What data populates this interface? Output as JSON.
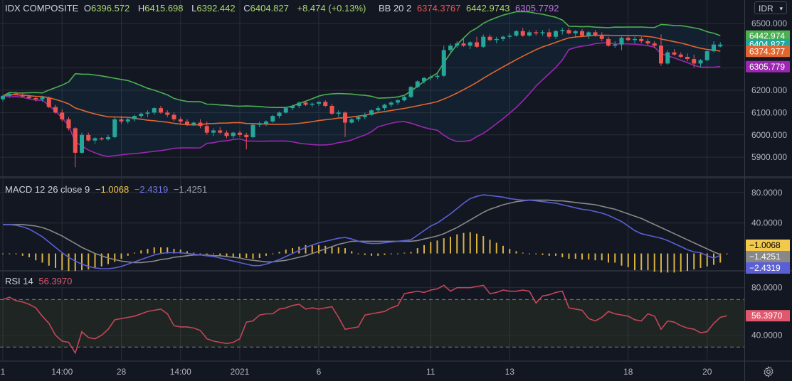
{
  "header": {
    "symbol": "IDX COMPOSITE",
    "open_label": "O",
    "open": "6396.572",
    "high_label": "H",
    "high": "6415.698",
    "low_label": "L",
    "low": "6392.442",
    "close_label": "C",
    "close": "6404.827",
    "change": "+8.474 (+0.13%)",
    "bb_label": "BB 20 2",
    "bb_mid": "6374.3767",
    "bb_upper": "6442.9743",
    "bb_lower": "6305.7792"
  },
  "macd_header": {
    "label": "MACD 12 26 close 9",
    "hist": "−1.0068",
    "macd": "−2.4319",
    "signal": "−1.4251"
  },
  "rsi_header": {
    "label": "RSI 14",
    "value": "56.3970"
  },
  "currency": "IDR",
  "colors": {
    "bg": "#131722",
    "grid": "#2a2e39",
    "up": "#26a69a",
    "down": "#ef5350",
    "bb_upper": "#4caf50",
    "bb_mid": "#e0662f",
    "bb_lower": "#9c27b0",
    "macd": "#5b5fd4",
    "signal": "#888888",
    "hist": "#d9b23f",
    "rsi": "#c4455a",
    "last_price": "#26a69a"
  },
  "chart_data": [
    {
      "type": "candlestick",
      "title": "IDX COMPOSITE",
      "ylim": [
        5840,
        6525
      ],
      "y_ticks": [
        "6500.000",
        "6400.000",
        "6300.000",
        "6200.000",
        "6100.000",
        "6000.000",
        "5900.000"
      ],
      "x_tick_labels": [
        "1",
        "14:00",
        "28",
        "14:00",
        "2021",
        "6",
        "11",
        "13",
        "18",
        "20"
      ],
      "price_labels": [
        {
          "value": 6442.974,
          "text": "6442.974",
          "color": "#4caf50"
        },
        {
          "value": 6404.827,
          "text": "6404.827",
          "color": "#26a69a"
        },
        {
          "value": 6374.377,
          "text": "6374.377",
          "color": "#e0662f"
        },
        {
          "value": 6305.779,
          "text": "6305.779",
          "color": "#9c27b0"
        }
      ],
      "candles": [
        [
          6160,
          6178,
          6150,
          6175
        ],
        [
          6175,
          6190,
          6168,
          6185
        ],
        [
          6185,
          6195,
          6178,
          6180
        ],
        [
          6180,
          6188,
          6170,
          6172
        ],
        [
          6172,
          6180,
          6160,
          6165
        ],
        [
          6165,
          6172,
          6150,
          6160
        ],
        [
          6160,
          6175,
          6150,
          6168
        ],
        [
          6168,
          6172,
          6120,
          6125
        ],
        [
          6125,
          6135,
          6095,
          6100
        ],
        [
          6100,
          6115,
          6060,
          6070
        ],
        [
          6070,
          6080,
          6020,
          6030
        ],
        [
          6030,
          6035,
          5855,
          5920
        ],
        [
          5920,
          6010,
          5915,
          6000
        ],
        [
          6000,
          6010,
          5970,
          5975
        ],
        [
          5975,
          5990,
          5960,
          5985
        ],
        [
          5985,
          5990,
          5975,
          5980
        ],
        [
          5980,
          6000,
          5975,
          5990
        ],
        [
          5990,
          6080,
          5985,
          6070
        ],
        [
          6070,
          6085,
          6050,
          6060
        ],
        [
          6060,
          6080,
          6050,
          6070
        ],
        [
          6070,
          6090,
          6060,
          6085
        ],
        [
          6085,
          6100,
          6075,
          6095
        ],
        [
          6095,
          6110,
          6080,
          6100
        ],
        [
          6100,
          6125,
          6090,
          6120
        ],
        [
          6120,
          6130,
          6095,
          6100
        ],
        [
          6100,
          6110,
          6080,
          6090
        ],
        [
          6090,
          6100,
          6060,
          6070
        ],
        [
          6070,
          6080,
          6050,
          6060
        ],
        [
          6060,
          6070,
          6040,
          6045
        ],
        [
          6045,
          6060,
          6040,
          6055
        ],
        [
          6055,
          6070,
          6030,
          6040
        ],
        [
          6040,
          6060,
          6000,
          6010
        ],
        [
          6010,
          6030,
          5995,
          6020
        ],
        [
          6020,
          6035,
          6005,
          6010
        ],
        [
          6010,
          6020,
          5985,
          5995
        ],
        [
          5995,
          6015,
          5985,
          6010
        ],
        [
          6010,
          6020,
          5990,
          6000
        ],
        [
          6000,
          6010,
          5935,
          5990
        ],
        [
          5990,
          6050,
          5985,
          6045
        ],
        [
          6045,
          6060,
          6035,
          6050
        ],
        [
          6050,
          6065,
          6040,
          6060
        ],
        [
          6060,
          6090,
          6055,
          6085
        ],
        [
          6085,
          6105,
          6075,
          6100
        ],
        [
          6100,
          6125,
          6095,
          6120
        ],
        [
          6120,
          6135,
          6110,
          6130
        ],
        [
          6130,
          6150,
          6120,
          6145
        ],
        [
          6145,
          6150,
          6130,
          6135
        ],
        [
          6135,
          6145,
          6125,
          6140
        ],
        [
          6140,
          6150,
          6130,
          6148
        ],
        [
          6148,
          6155,
          6125,
          6130
        ],
        [
          6130,
          6140,
          6090,
          6095
        ],
        [
          6095,
          6110,
          6080,
          6100
        ],
        [
          6100,
          6105,
          5990,
          6055
        ],
        [
          6055,
          6075,
          6050,
          6070
        ],
        [
          6070,
          6085,
          6060,
          6080
        ],
        [
          6080,
          6100,
          6070,
          6090
        ],
        [
          6090,
          6115,
          6085,
          6110
        ],
        [
          6110,
          6130,
          6100,
          6120
        ],
        [
          6120,
          6140,
          6110,
          6135
        ],
        [
          6135,
          6150,
          6125,
          6145
        ],
        [
          6145,
          6160,
          6135,
          6155
        ],
        [
          6155,
          6175,
          6150,
          6170
        ],
        [
          6170,
          6220,
          6165,
          6215
        ],
        [
          6215,
          6245,
          6210,
          6240
        ],
        [
          6240,
          6260,
          6230,
          6255
        ],
        [
          6255,
          6270,
          6245,
          6260
        ],
        [
          6260,
          6275,
          6250,
          6265
        ],
        [
          6265,
          6400,
          6260,
          6380
        ],
        [
          6380,
          6410,
          6370,
          6400
        ],
        [
          6400,
          6420,
          6390,
          6410
        ],
        [
          6410,
          6430,
          6395,
          6400
        ],
        [
          6400,
          6420,
          6385,
          6415
        ],
        [
          6415,
          6440,
          6390,
          6395
        ],
        [
          6395,
          6450,
          6390,
          6440
        ],
        [
          6440,
          6450,
          6420,
          6425
        ],
        [
          6425,
          6440,
          6410,
          6430
        ],
        [
          6430,
          6445,
          6420,
          6440
        ],
        [
          6440,
          6455,
          6430,
          6445
        ],
        [
          6445,
          6470,
          6440,
          6465
        ],
        [
          6465,
          6480,
          6440,
          6445
        ],
        [
          6445,
          6470,
          6440,
          6460
        ],
        [
          6460,
          6470,
          6445,
          6455
        ],
        [
          6455,
          6470,
          6445,
          6460
        ],
        [
          6460,
          6475,
          6430,
          6440
        ],
        [
          6440,
          6470,
          6430,
          6465
        ],
        [
          6465,
          6480,
          6450,
          6470
        ],
        [
          6470,
          6480,
          6450,
          6455
        ],
        [
          6455,
          6470,
          6435,
          6465
        ],
        [
          6465,
          6475,
          6440,
          6445
        ],
        [
          6445,
          6465,
          6430,
          6460
        ],
        [
          6460,
          6470,
          6440,
          6445
        ],
        [
          6445,
          6460,
          6420,
          6430
        ],
        [
          6430,
          6440,
          6395,
          6400
        ],
        [
          6400,
          6420,
          6390,
          6405
        ],
        [
          6405,
          6440,
          6380,
          6435
        ],
        [
          6435,
          6445,
          6420,
          6425
        ],
        [
          6425,
          6440,
          6410,
          6430
        ],
        [
          6430,
          6440,
          6410,
          6420
        ],
        [
          6420,
          6430,
          6400,
          6410
        ],
        [
          6410,
          6420,
          6390,
          6400
        ],
        [
          6400,
          6450,
          6310,
          6320
        ],
        [
          6320,
          6380,
          6315,
          6370
        ],
        [
          6370,
          6385,
          6355,
          6360
        ],
        [
          6360,
          6370,
          6345,
          6350
        ],
        [
          6350,
          6365,
          6330,
          6340
        ],
        [
          6340,
          6360,
          6300,
          6320
        ],
        [
          6320,
          6340,
          6305,
          6335
        ],
        [
          6335,
          6380,
          6330,
          6375
        ],
        [
          6375,
          6420,
          6370,
          6405
        ],
        [
          6396.572,
          6415.698,
          6392.442,
          6404.827
        ]
      ]
    },
    {
      "type": "line",
      "title": "MACD 12 26 close 9",
      "ylim": [
        -20,
        92
      ],
      "y_ticks": [
        "80.0000",
        "40.0000"
      ],
      "series": [
        {
          "name": "MACD",
          "values": [
            38,
            38,
            37,
            35,
            32,
            27,
            22,
            15,
            8,
            1,
            -5,
            -10,
            -14,
            -17,
            -19,
            -20,
            -20,
            -19,
            -17,
            -14,
            -11,
            -8,
            -5,
            -2,
            0,
            1,
            1,
            1,
            0,
            -1,
            -2,
            -3,
            -4,
            -6,
            -8,
            -10,
            -12,
            -14,
            -16,
            -16,
            -14,
            -11,
            -8,
            -4,
            0,
            4,
            8,
            11,
            14,
            16,
            18,
            20,
            21,
            19,
            16,
            14,
            13,
            13,
            14,
            15,
            16,
            17,
            18,
            24,
            30,
            36,
            40,
            46,
            52,
            59,
            66,
            72,
            75,
            77,
            76,
            75,
            74,
            72,
            71,
            70,
            70,
            69,
            68,
            67,
            66,
            64,
            62,
            60,
            58,
            57,
            55,
            53,
            50,
            46,
            42,
            36,
            30,
            26,
            24,
            22,
            20,
            17,
            13,
            9,
            5,
            2,
            1,
            -3,
            -6,
            -2.4319
          ]
        },
        {
          "name": "Signal",
          "values": [
            38,
            38,
            38,
            38,
            37,
            36,
            34,
            31,
            27,
            23,
            18,
            13,
            8,
            4,
            0,
            -3,
            -6,
            -8,
            -10,
            -11,
            -12,
            -12,
            -11,
            -10,
            -8,
            -7,
            -5,
            -4,
            -3,
            -2,
            -2,
            -2,
            -3,
            -3,
            -4,
            -5,
            -6,
            -8,
            -9,
            -10,
            -11,
            -11,
            -10,
            -9,
            -7,
            -5,
            -3,
            0,
            3,
            6,
            9,
            12,
            14,
            16,
            16,
            16,
            16,
            16,
            16,
            16,
            16,
            16,
            16,
            17,
            19,
            21,
            23,
            26,
            30,
            34,
            39,
            44,
            49,
            54,
            58,
            61,
            64,
            66,
            68,
            69,
            70,
            70,
            70,
            70,
            69,
            69,
            68,
            67,
            66,
            65,
            64,
            62,
            60,
            58,
            55,
            52,
            49,
            46,
            42,
            38,
            34,
            30,
            26,
            22,
            18,
            14,
            10,
            6,
            2,
            -1.4251
          ]
        },
        {
          "name": "Histogram",
          "values": [
            0,
            0,
            -1,
            -3,
            -5,
            -9,
            -12,
            -16,
            -19,
            -22,
            -23,
            -23,
            -22,
            -21,
            -19,
            -17,
            -14,
            -11,
            -7,
            -3,
            1,
            4,
            6,
            8,
            8,
            8,
            6,
            5,
            3,
            1,
            0,
            -1,
            -1,
            -3,
            -4,
            -5,
            -6,
            -6,
            -7,
            -6,
            -3,
            0,
            2,
            5,
            7,
            9,
            11,
            11,
            11,
            10,
            9,
            8,
            7,
            3,
            0,
            -2,
            -3,
            -3,
            -2,
            -1,
            0,
            1,
            2,
            7,
            11,
            15,
            17,
            20,
            22,
            25,
            27,
            28,
            26,
            23,
            18,
            14,
            10,
            6,
            3,
            1,
            0,
            -1,
            -2,
            -3,
            -3,
            -5,
            -7,
            -7,
            -8,
            -8,
            -9,
            -9,
            -12,
            -12,
            -16,
            -18,
            -22,
            -22,
            -22,
            -24,
            -25,
            -25,
            -25,
            -24,
            -23,
            -21,
            -19,
            -17,
            -15,
            -12,
            -1.0068
          ]
        }
      ],
      "value_labels": [
        {
          "value": -1.0068,
          "text": "−1.0068",
          "color": "#f2c94c",
          "text_color": "#000"
        },
        {
          "value": -1.4251,
          "text": "−1.4251",
          "color": "#888888",
          "text_color": "#fff"
        },
        {
          "value": -2.4319,
          "text": "−2.4319",
          "color": "#5b5fd4",
          "text_color": "#fff"
        }
      ]
    },
    {
      "type": "line",
      "title": "RSI 14",
      "ylim": [
        20,
        90
      ],
      "y_ticks": [
        "80.0000",
        "40.0000"
      ],
      "bands": [
        30,
        70
      ],
      "series": [
        {
          "name": "RSI",
          "values": [
            70,
            72,
            69,
            68,
            66,
            63,
            56,
            50,
            40,
            35,
            34,
            25,
            43,
            38,
            37,
            40,
            45,
            53,
            54,
            55,
            56,
            58,
            60,
            61,
            62,
            58,
            48,
            47,
            47,
            46,
            44,
            37,
            35,
            34,
            33,
            34,
            37,
            51,
            52,
            57,
            58,
            58,
            62,
            63,
            65,
            66,
            62,
            63,
            62,
            63,
            64,
            55,
            45,
            46,
            47,
            57,
            58,
            59,
            60,
            63,
            65,
            75,
            76,
            77,
            76,
            78,
            79,
            82,
            77,
            80,
            80,
            80,
            81,
            82,
            75,
            76,
            78,
            77,
            77,
            78,
            77,
            67,
            73,
            74,
            76,
            77,
            63,
            62,
            61,
            54,
            52,
            55,
            60,
            58,
            57,
            56,
            53,
            52,
            58,
            56,
            45,
            52,
            51,
            48,
            46,
            45,
            42,
            43,
            50,
            55,
            56.397
          ]
        }
      ],
      "value_labels": [
        {
          "value": 56.397,
          "text": "56.3970",
          "color": "#e0586e",
          "text_color": "#fff"
        }
      ]
    }
  ]
}
